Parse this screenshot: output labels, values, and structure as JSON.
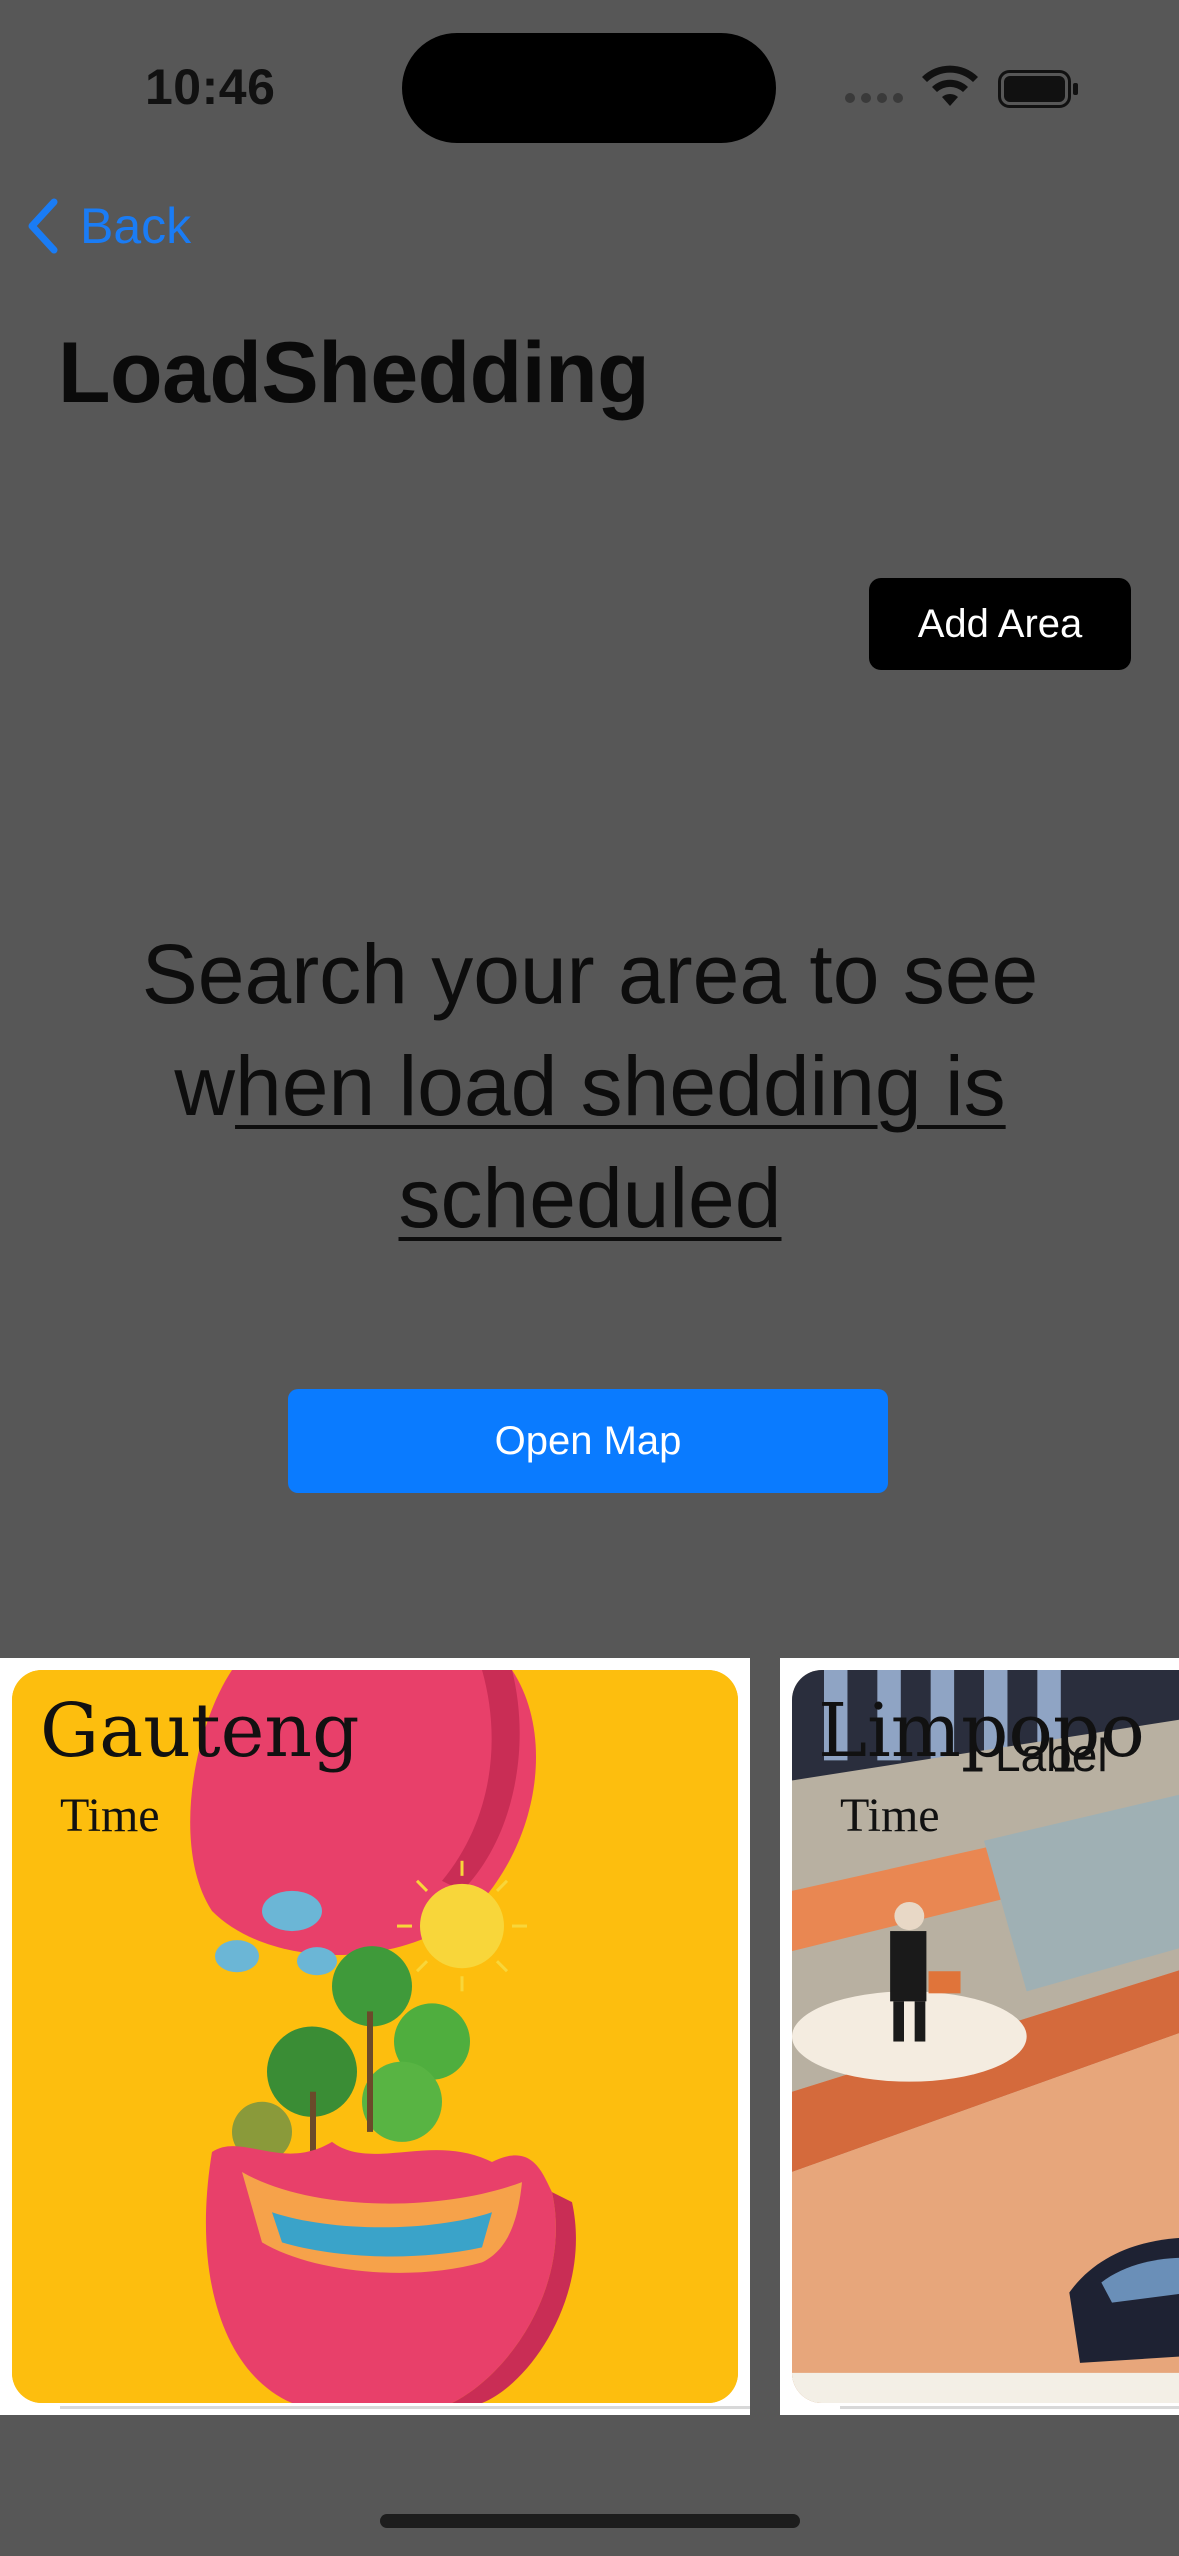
{
  "status_bar": {
    "time": "10:46",
    "icons": [
      "signal-icon",
      "wifi-icon",
      "battery-icon"
    ]
  },
  "nav": {
    "back_label": "Back"
  },
  "page": {
    "title": "LoadShedding",
    "add_area_label": "Add  Area",
    "message_line1": "Search your area to see",
    "message_line2_plain": "w",
    "message_line2_underlined": "hen load shedding is",
    "message_line3": "scheduled",
    "open_map_label": "Open Map"
  },
  "cards": [
    {
      "name": "Gauteng",
      "time": "Time"
    },
    {
      "name": "Limpopo",
      "time": "Time",
      "extra_label": "Label"
    }
  ],
  "colors": {
    "background": "#575757",
    "accent": "#0a7bff",
    "back_link": "#1a7cf5",
    "card1_bg": "#fdbe0e"
  }
}
